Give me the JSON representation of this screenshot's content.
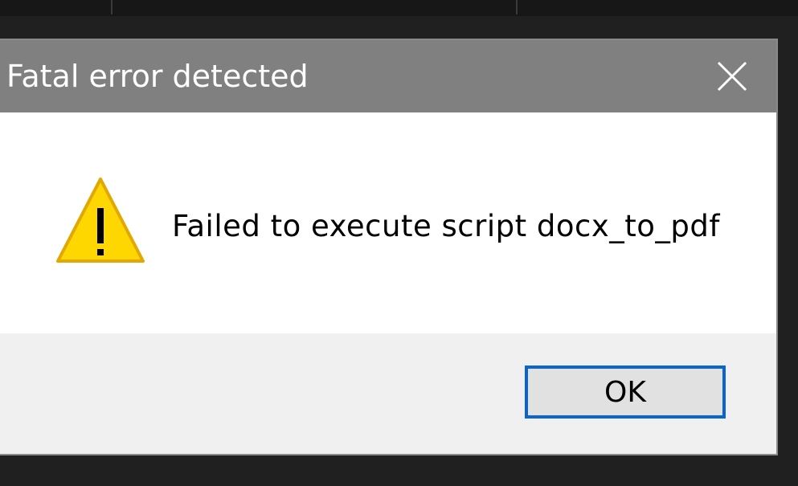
{
  "dialog": {
    "title": "Fatal error detected",
    "message": "Failed to execute script docx_to_pdf",
    "icon": "warning-icon",
    "close_icon": "close-icon",
    "ok_label": "OK"
  },
  "colors": {
    "titlebar": "#808080",
    "accent": "#0a64d0",
    "warning_fill": "#ffd700",
    "warning_stroke": "#e0a800",
    "footer": "#f0f0f0"
  }
}
